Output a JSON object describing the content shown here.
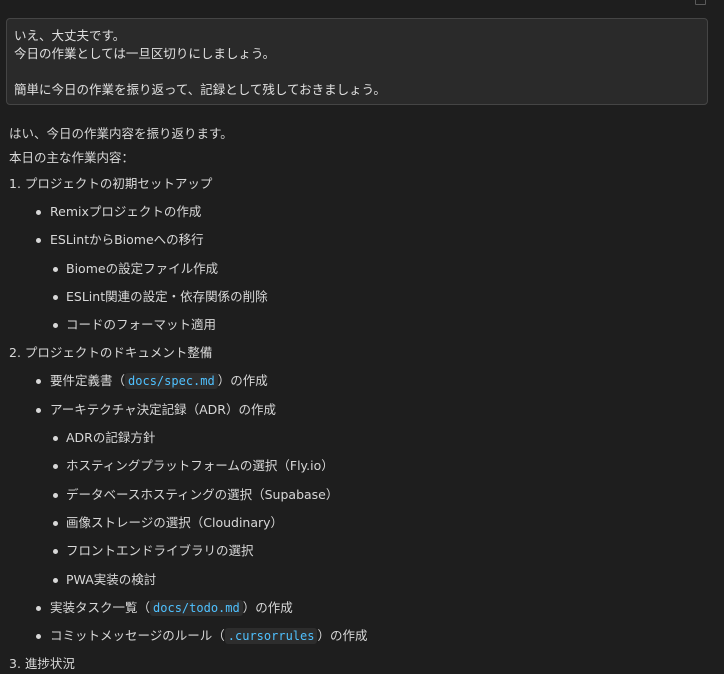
{
  "user_message": {
    "lines": [
      "いえ、大丈夫です。",
      "今日の作業としては一旦区切りにしましょう。",
      "",
      "簡単に今日の作業を振り返って、記録として残しておきましょう。"
    ]
  },
  "assistant": {
    "intro": "はい、今日の作業内容を振り返ります。",
    "heading": "本日の主な作業内容：",
    "sections": [
      {
        "title": "1. プロジェクトの初期セットアップ",
        "items": [
          {
            "text": "Remixプロジェクトの作成"
          },
          {
            "text": "ESLintからBiomeへの移行"
          }
        ],
        "subitems": [
          "Biomeの設定ファイル作成",
          "ESLint関連の設定・依存関係の削除",
          "コードのフォーマット適用"
        ]
      },
      {
        "title": "2. プロジェクトのドキュメント整備",
        "spec": {
          "before": "要件定義書（",
          "code": "docs/spec.md",
          "after": "）の作成"
        },
        "adr": "アーキテクチャ決定記録（ADR）の作成",
        "adr_subitems": [
          "ADRの記録方針",
          "ホスティングプラットフォームの選択（Fly.io）",
          "データベースホスティングの選択（Supabase）",
          "画像ストレージの選択（Cloudinary）",
          "フロントエンドライブラリの選択",
          "PWA実装の検討"
        ],
        "todo": {
          "before": "実装タスク一覧（",
          "code": "docs/todo.md",
          "after": "）の作成"
        },
        "rules": {
          "before": "コミットメッセージのルール（",
          "code": ".cursorrules",
          "after": "）の作成"
        }
      },
      {
        "title": "3. 進捗状況"
      }
    ]
  },
  "colors": {
    "background": "#1e1e1e",
    "message_box": "#2a2a2a",
    "code_text": "#4fc1ff"
  }
}
